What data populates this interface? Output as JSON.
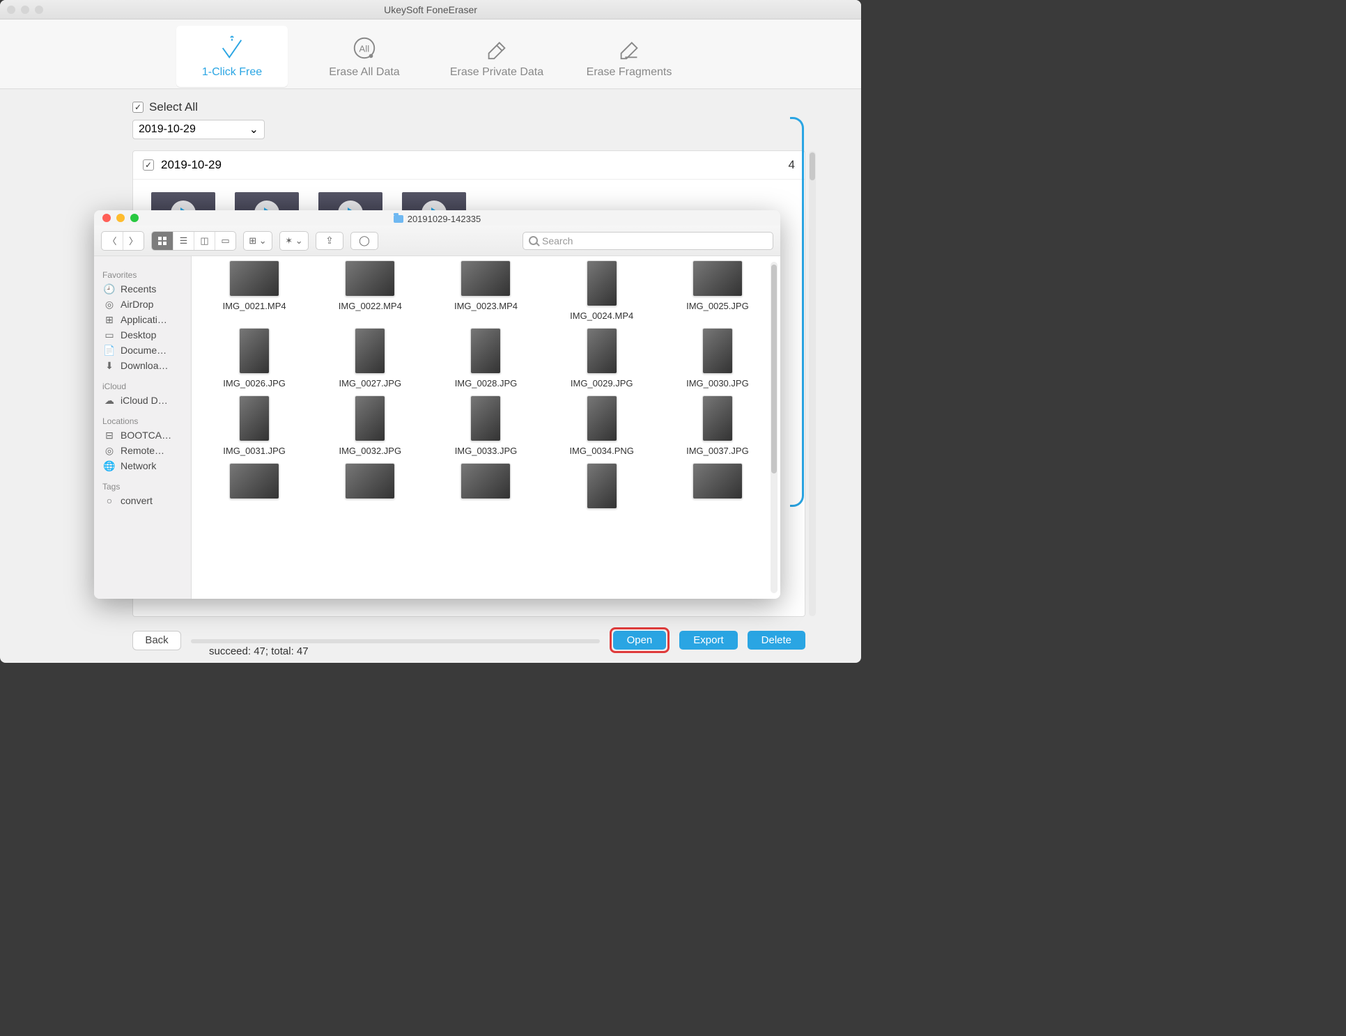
{
  "app": {
    "title": "UkeySoft FoneEraser"
  },
  "tabs": {
    "click_free": "1-Click Free",
    "erase_all": "Erase All Data",
    "erase_private": "Erase Private Data",
    "erase_fragments": "Erase Fragments"
  },
  "selection": {
    "select_all": "Select All",
    "date": "2019-10-29",
    "group_date": "2019-10-29",
    "group_count": "4"
  },
  "footer": {
    "back": "Back",
    "open": "Open",
    "export": "Export",
    "delete": "Delete",
    "status": "succeed: 47; total: 47"
  },
  "finder": {
    "folder": "20191029-142335",
    "search_placeholder": "Search",
    "sidebar": {
      "favorites_title": "Favorites",
      "favorites": [
        "Recents",
        "AirDrop",
        "Applicati…",
        "Desktop",
        "Docume…",
        "Downloa…"
      ],
      "icloud_title": "iCloud",
      "icloud": [
        "iCloud D…"
      ],
      "locations_title": "Locations",
      "locations": [
        "BOOTCA…",
        "Remote…",
        "Network"
      ],
      "tags_title": "Tags",
      "tags": [
        "convert"
      ]
    },
    "files": [
      {
        "name": "IMG_0021.MP4",
        "shape": "land"
      },
      {
        "name": "IMG_0022.MP4",
        "shape": "land"
      },
      {
        "name": "IMG_0023.MP4",
        "shape": "land"
      },
      {
        "name": "IMG_0024.MP4",
        "shape": "port"
      },
      {
        "name": "IMG_0025.JPG",
        "shape": "land"
      },
      {
        "name": "IMG_0026.JPG",
        "shape": "port"
      },
      {
        "name": "IMG_0027.JPG",
        "shape": "port"
      },
      {
        "name": "IMG_0028.JPG",
        "shape": "port"
      },
      {
        "name": "IMG_0029.JPG",
        "shape": "port"
      },
      {
        "name": "IMG_0030.JPG",
        "shape": "port"
      },
      {
        "name": "IMG_0031.JPG",
        "shape": "port"
      },
      {
        "name": "IMG_0032.JPG",
        "shape": "port"
      },
      {
        "name": "IMG_0033.JPG",
        "shape": "port"
      },
      {
        "name": "IMG_0034.PNG",
        "shape": "port"
      },
      {
        "name": "IMG_0037.JPG",
        "shape": "port"
      },
      {
        "name": "",
        "shape": "land"
      },
      {
        "name": "",
        "shape": "land"
      },
      {
        "name": "",
        "shape": "land"
      },
      {
        "name": "",
        "shape": "port"
      },
      {
        "name": "",
        "shape": "land"
      }
    ]
  }
}
